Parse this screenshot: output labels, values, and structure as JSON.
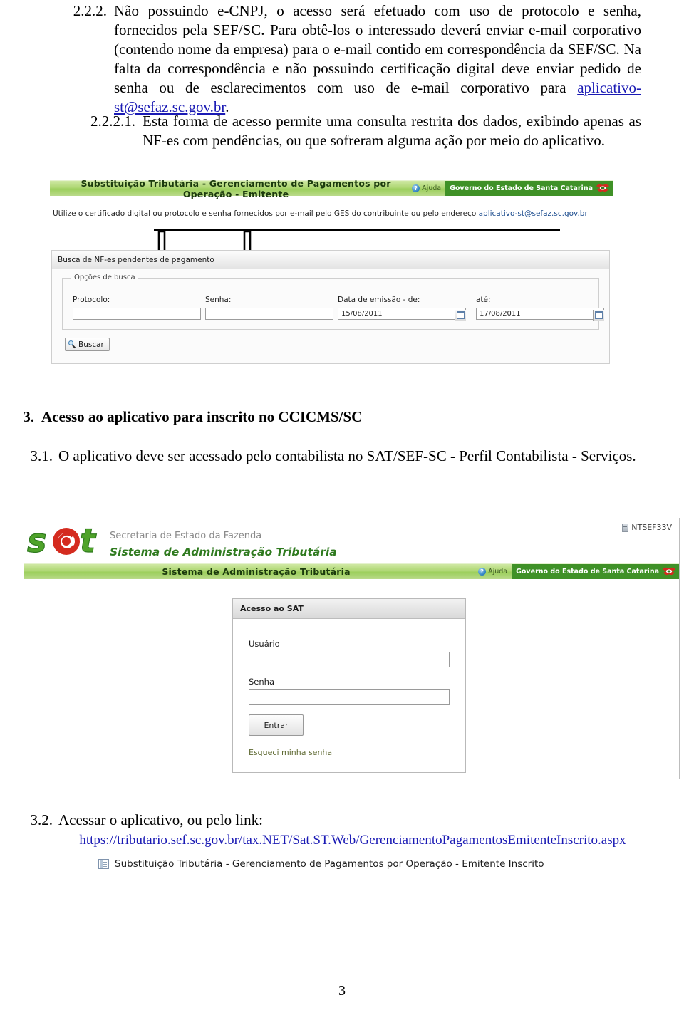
{
  "document": {
    "page_number": "3",
    "paragraphs": [
      {
        "number": "2.2.2.",
        "text_parts": [
          {
            "t": "Não possuindo e-CNPJ, o acesso será efetuado com uso de protocolo e senha, fornecidos pela SEF/SC. Para obtê-los o interessado deverá enviar e-mail corporativo (contendo nome da empresa) para o e-mail contido em correspondência da SEF/SC. Na falta da correspondência e não possuindo certificação digital deve enviar pedido de senha ou de esclarecimentos com uso de e-mail corporativo para "
          },
          {
            "t": "aplicativo-st@sefaz.sc.gov.br",
            "link": true
          },
          {
            "t": "."
          }
        ]
      },
      {
        "number": "2.2.2.1.",
        "text_parts": [
          {
            "t": "Esta forma de acesso permite uma consulta restrita dos dados, exibindo apenas as NF-es com pendências, ou que sofreram alguma ação por meio do aplicativo."
          }
        ]
      }
    ],
    "section3": {
      "number": "3.",
      "heading": "Acesso ao aplicativo para inscrito no CCICMS/SC",
      "item31_number": "3.1.",
      "item31_text": "O aplicativo deve ser acessado pelo contabilista no SAT/SEF-SC - Perfil Contabilista - Serviços.",
      "item32_number": "3.2.",
      "item32_text": "Acessar o aplicativo, ou pelo link:",
      "item32_link": "https://tributario.sef.sc.gov.br/tax.NET/Sat.ST.Web/GerenciamentoPagamentosEmitenteInscrito.aspx"
    },
    "shortcut_label": "Substituição Tributária - Gerenciamento de Pagamentos por Operação - Emitente Inscrito"
  },
  "screenshot1": {
    "appbar": {
      "title": "Substituição Tributária - Gerenciamento de Pagamentos por Operação - Emitente",
      "help_label": "Ajuda",
      "gov_label": "Governo do Estado de Santa Catarina",
      "accent_green": "#9ccf5c",
      "gov_green": "#3f9127"
    },
    "instruction_prefix": "Utilize o certificado digital ou protocolo e senha fornecidos por e-mail pelo GES do contribuinte ou pelo endereço ",
    "instruction_link": "aplicativo-st@sefaz.sc.gov.br",
    "panel_title": "Busca de NF-es pendentes de pagamento",
    "fieldset_legend": "Opções de busca",
    "fields": [
      {
        "label": "Protocolo:",
        "value": ""
      },
      {
        "label": "Senha:",
        "value": ""
      },
      {
        "label": "Data de emissão - de:",
        "value": "15/08/2011"
      },
      {
        "label": "até:",
        "value": "17/08/2011"
      }
    ],
    "search_button": "Buscar"
  },
  "screenshot2": {
    "logo_text": "s@t",
    "brand_line1": "Secretaria de Estado da Fazenda",
    "brand_line2": "Sistema de Administração Tributária",
    "server_name": "NTSEF33V",
    "appbar": {
      "title": "Sistema de Administração Tributária",
      "help_label": "Ajuda",
      "gov_label": "Governo do Estado de Santa Catarina"
    },
    "login": {
      "card_title": "Acesso ao SAT",
      "user_label": "Usuário",
      "user_value": "",
      "password_label": "Senha",
      "password_value": "",
      "submit_label": "Entrar",
      "forgot_label": "Esqueci minha senha"
    }
  }
}
